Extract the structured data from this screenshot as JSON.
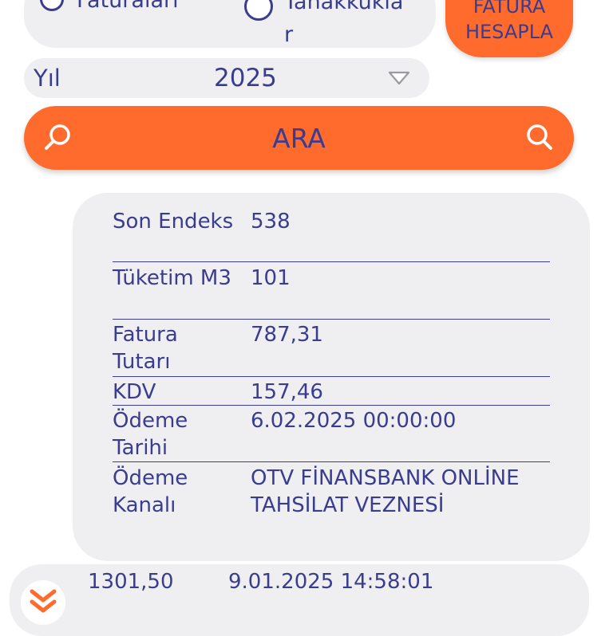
{
  "top_options": {
    "option1_label": "Faturaları",
    "option2_label_line1": "Tahakkukla",
    "option2_label_line2": "r",
    "calc_button_line1": "FATURA",
    "calc_button_line2": "HESAPLA"
  },
  "year_filter": {
    "label": "Yıl",
    "selected": "2025"
  },
  "search": {
    "label": "ARA"
  },
  "detail": {
    "rows": [
      {
        "label": "Son Endeks",
        "value": "538"
      },
      {
        "label": "Tüketim M3",
        "value": "101"
      },
      {
        "label": "Fatura Tutarı",
        "value": "787,31"
      },
      {
        "label": "KDV",
        "value": "157,46"
      },
      {
        "label": "Ödeme Tarihi",
        "value": "6.02.2025 00:00:00"
      },
      {
        "label": "Ödeme Kanalı",
        "value": "OTV FİNANSBANK ONLİNE TAHSİLAT VEZNESİ"
      }
    ]
  },
  "list": {
    "items": [
      {
        "amount": "1301,50",
        "date": "9.01.2025 14:58:01"
      }
    ]
  },
  "colors": {
    "accent": "#ff6b2c",
    "text": "#3a3d8f",
    "card": "#efeff1"
  },
  "icons": {
    "search_left": "search-icon",
    "search_right": "search-icon",
    "dropdown": "triangle-down-icon",
    "expand": "double-chevron-down-icon"
  }
}
